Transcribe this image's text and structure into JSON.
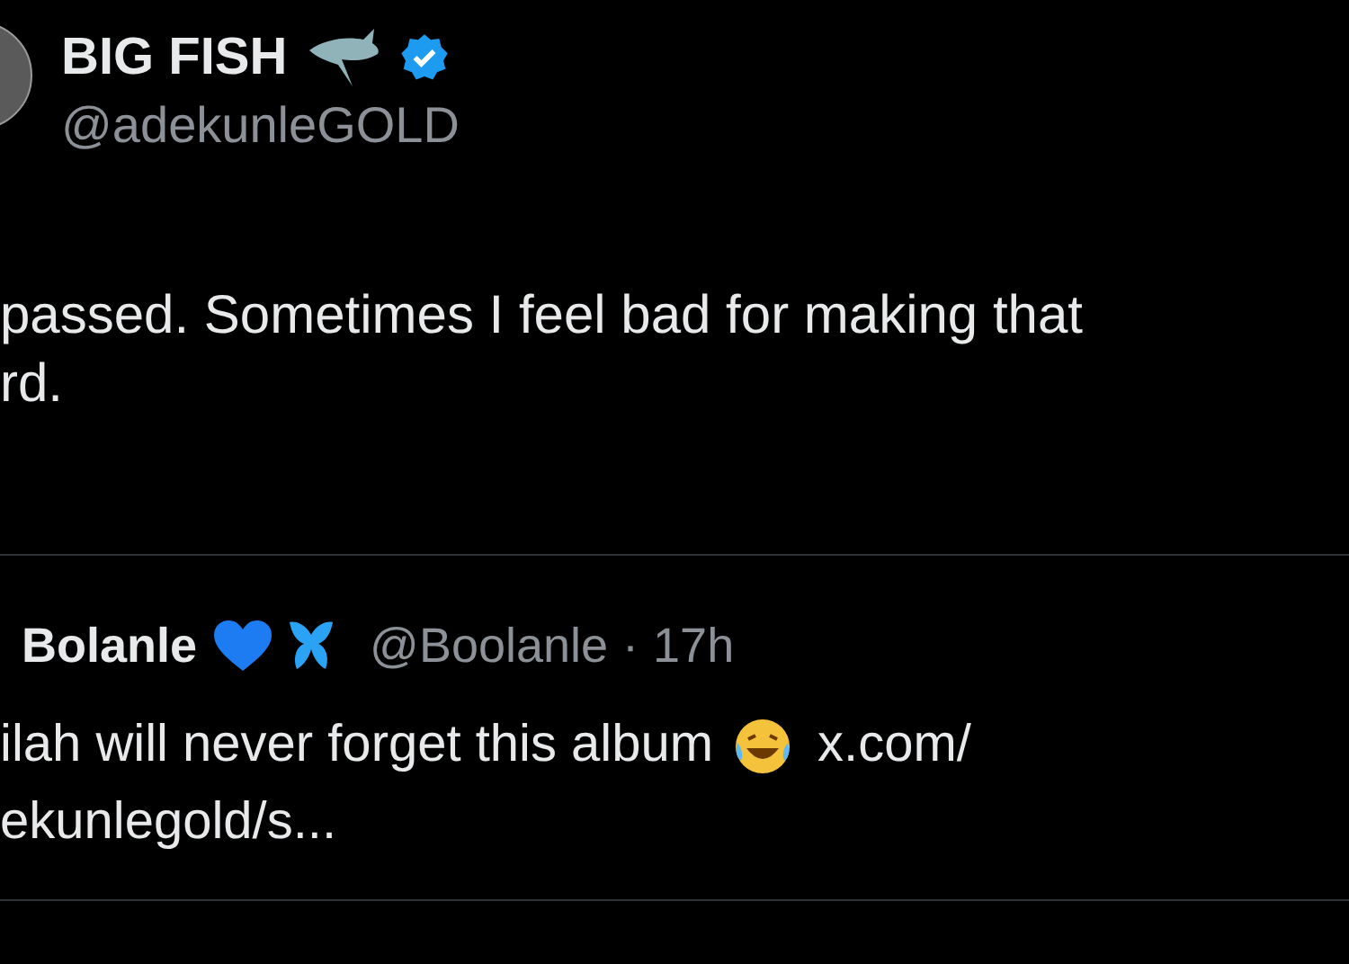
{
  "author": {
    "name": "BIG FISH",
    "verified": true,
    "handle": "@adekunleGOLD"
  },
  "post": {
    "lines": [
      "passed. Sometimes I feel bad for making that",
      "rd."
    ]
  },
  "reply": {
    "name": "Bolanle",
    "handle": "@Boolanle",
    "separator": "·",
    "time": "17h",
    "lines": [
      "ilah will never forget this album",
      "x.com/",
      "ekunlegold/s..."
    ]
  }
}
